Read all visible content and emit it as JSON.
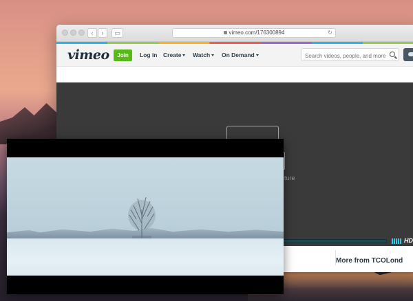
{
  "browser": {
    "url": "vimeo.com/176300894",
    "reload_icon": "reload-icon",
    "lock_icon": "lock-icon"
  },
  "vimeo_nav": {
    "logo": "vimeo",
    "join": "Join",
    "login": "Log in",
    "create": "Create",
    "watch": "Watch",
    "on_demand": "On Demand",
    "search_placeholder": "Search videos, people, and more"
  },
  "player": {
    "pip_message": "in Picture",
    "hd_label": "HD"
  },
  "below_player": {
    "more_from": "More from TCOLond"
  },
  "colors": {
    "vimeo_green": "#5ab91a",
    "player_bg": "#3a3a3a",
    "accent_blue": "#34c6e8"
  }
}
